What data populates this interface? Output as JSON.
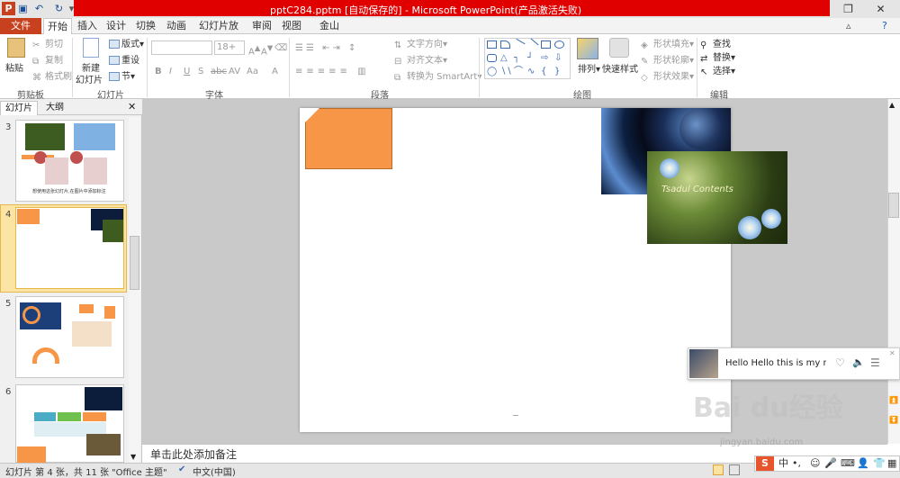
{
  "window": {
    "title": "pptC284.pptm [自动保存的] - Microsoft PowerPoint(产品激活失败)",
    "app_icon": "P"
  },
  "tabs": [
    "文件",
    "开始",
    "插入",
    "设计",
    "切换",
    "动画",
    "幻灯片放映",
    "审阅",
    "视图",
    "金山PDF"
  ],
  "clipboard": {
    "paste": "粘贴",
    "cut": "剪切",
    "copy": "复制",
    "format_painter": "格式刷",
    "label": "剪贴板"
  },
  "slides_group": {
    "new_slide": "新建",
    "new_slide2": "幻灯片",
    "layout": "版式",
    "reset": "重设",
    "section": "节",
    "label": "幻灯片"
  },
  "font_group": {
    "size": "18+",
    "label": "字体",
    "bold": "B",
    "italic": "I",
    "underline": "U",
    "shadow": "S",
    "strike": "abc",
    "spacing": "AV",
    "case": "Aa"
  },
  "paragraph_group": {
    "text_direction": "文字方向",
    "align_text": "对齐文本",
    "smartart": "转换为 SmartArt",
    "label": "段落"
  },
  "drawing_group": {
    "arrange": "排列",
    "quick_styles": "快速样式",
    "fill": "形状填充",
    "outline": "形状轮廓",
    "effects": "形状效果",
    "label": "绘图"
  },
  "editing_group": {
    "find": "查找",
    "replace": "替换",
    "select": "选择",
    "label": "编辑"
  },
  "left_pane": {
    "tab_slides": "幻灯片",
    "tab_outline": "大纲",
    "slide_numbers": [
      "3",
      "4",
      "5",
      "6"
    ],
    "thumb3_caption": "想使用这张幻灯片,在图片中添加标注"
  },
  "slide": {
    "pic2_text": "Tsadul Contents"
  },
  "notes_placeholder": "单击此处添加备注",
  "status": {
    "slide_info": "幻灯片 第 4 张，共 11 张",
    "theme": "\"Office 主题\"",
    "language": "中文(中国)"
  },
  "popup": {
    "message": "Hello Hello this is my new"
  },
  "watermark": {
    "brand": "Bai du经验",
    "url": "jingyan.baidu.com"
  },
  "ime": {
    "mode": "中",
    "punct": "•,"
  }
}
